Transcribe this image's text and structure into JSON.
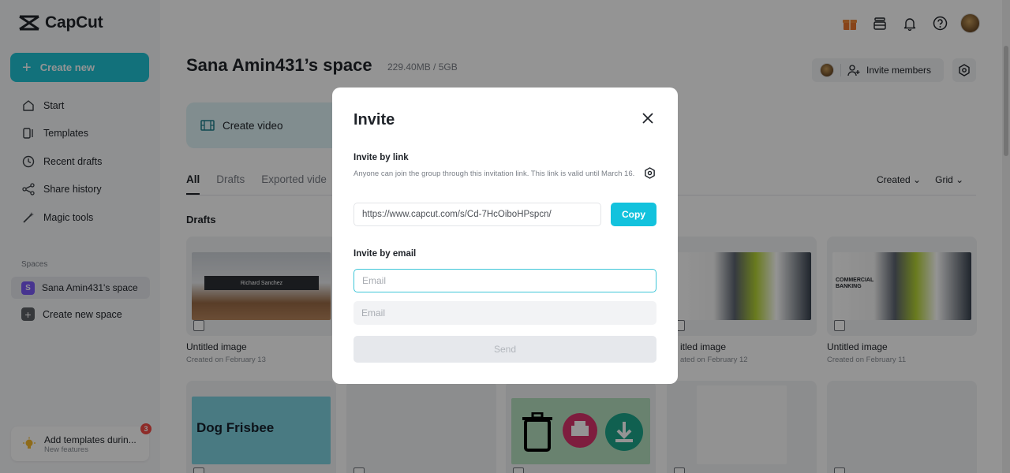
{
  "app": {
    "name": "CapCut"
  },
  "colors": {
    "accent": "#20c3d4",
    "copy": "#13c2dd",
    "space_badge": "#7a5af8",
    "notification": "#f54a45"
  },
  "sidebar": {
    "create_label": "Create new",
    "items": [
      {
        "label": "Start",
        "icon": "home-icon"
      },
      {
        "label": "Templates",
        "icon": "templates-icon"
      },
      {
        "label": "Recent drafts",
        "icon": "clock-icon"
      },
      {
        "label": "Share history",
        "icon": "share-icon"
      },
      {
        "label": "Magic tools",
        "icon": "magic-wand-icon"
      }
    ],
    "spaces_title": "Spaces",
    "space_badge": "S",
    "active_space": "Sana Amin431's space",
    "new_space_label": "Create new space",
    "promo": {
      "title": "Add templates durin...",
      "subtitle": "New features",
      "badge": "3"
    }
  },
  "header": {
    "title": "Sana Amin431’s space",
    "storage": "229.40MB / 5GB",
    "invite_label": "Invite members"
  },
  "main": {
    "create_video_label": "Create video",
    "tabs": [
      "All",
      "Drafts",
      "Exported vide"
    ],
    "sort_label": "Created",
    "view_label": "Grid",
    "drafts_title": "Drafts",
    "cards": [
      {
        "title": "Untitled image",
        "sub": "Created on February 13"
      },
      {
        "title": "itled image",
        "sub": "ated on February 12"
      },
      {
        "title": "Untitled image",
        "sub": "Created on February 11"
      }
    ],
    "thumb_texts": {
      "richard": "Richard Sanchez",
      "banking": "COMMERCIAL BANKING",
      "dog": "Dog Frisbee"
    }
  },
  "modal": {
    "title": "Invite",
    "link_section": "Invite by link",
    "link_desc": "Anyone can join the group through this invitation link. This link is valid until March 16.",
    "link_url": "https://www.capcut.com/s/Cd-7HcOiboHPspcn/",
    "copy_label": "Copy",
    "email_section": "Invite by email",
    "email_placeholder": "Email",
    "send_label": "Send"
  }
}
